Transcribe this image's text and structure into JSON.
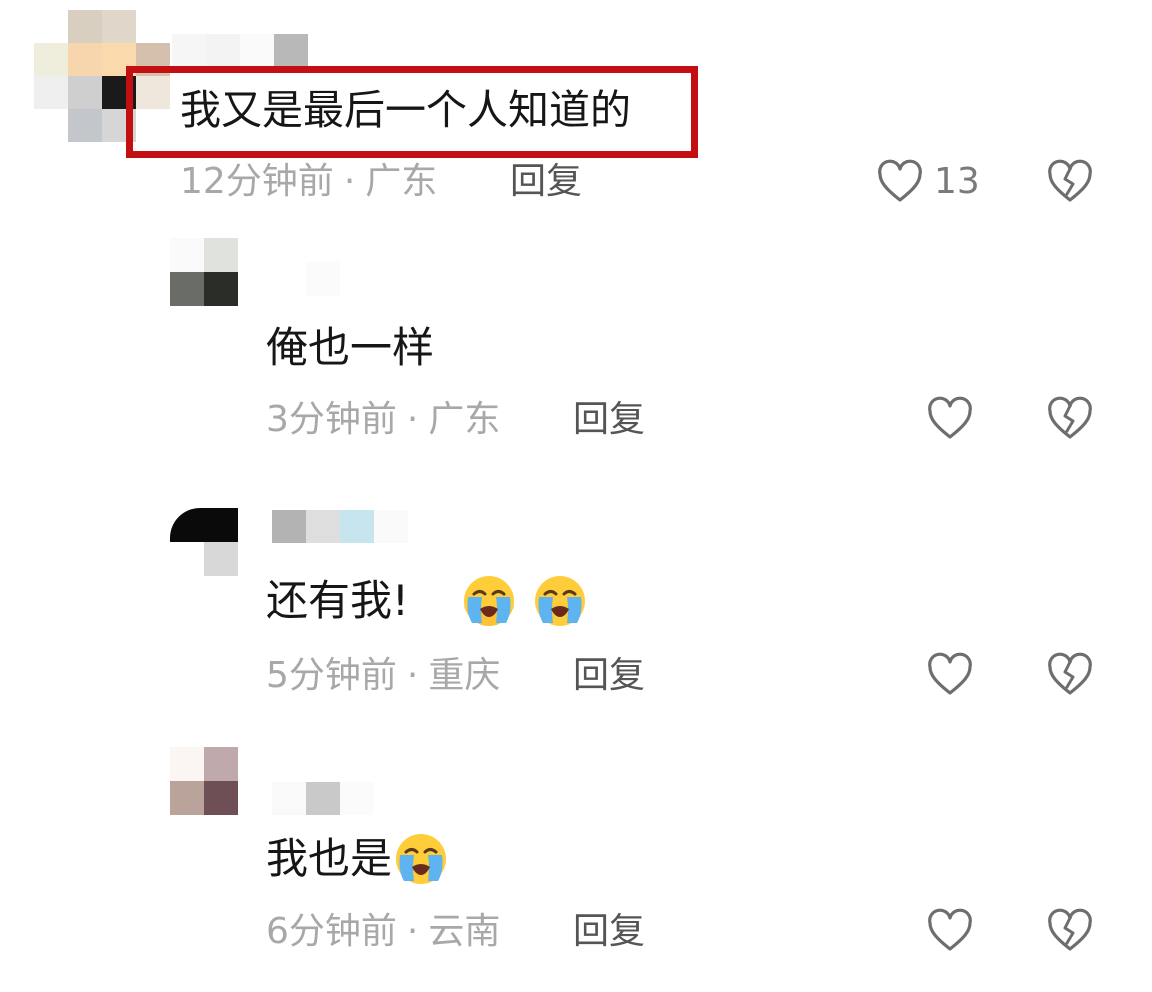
{
  "comments": [
    {
      "text": "我又是最后一个人知道的",
      "time": "12分钟前",
      "separator": "·",
      "location": "广东",
      "reply_label": "回复",
      "likes": "13",
      "emoji_count": 0
    },
    {
      "text": "俺也一样",
      "time": "3分钟前",
      "separator": "·",
      "location": "广东",
      "reply_label": "回复",
      "likes": "",
      "emoji_count": 0
    },
    {
      "text": "还有我!",
      "time": "5分钟前",
      "separator": "·",
      "location": "重庆",
      "reply_label": "回复",
      "likes": "",
      "emoji_count": 2
    },
    {
      "text": "我也是",
      "time": "6分钟前",
      "separator": "·",
      "location": "云南",
      "reply_label": "回复",
      "likes": "",
      "emoji_count": 1
    }
  ],
  "icons": {
    "like": "heart-outline-icon",
    "dislike": "broken-heart-icon",
    "emoji": "loudly-crying-face-icon"
  },
  "colors": {
    "highlight_border": "#c40f12",
    "text": "#161616",
    "meta": "#a8a8a8",
    "reply": "#555555",
    "icon_stroke": "#6e6e6e"
  }
}
